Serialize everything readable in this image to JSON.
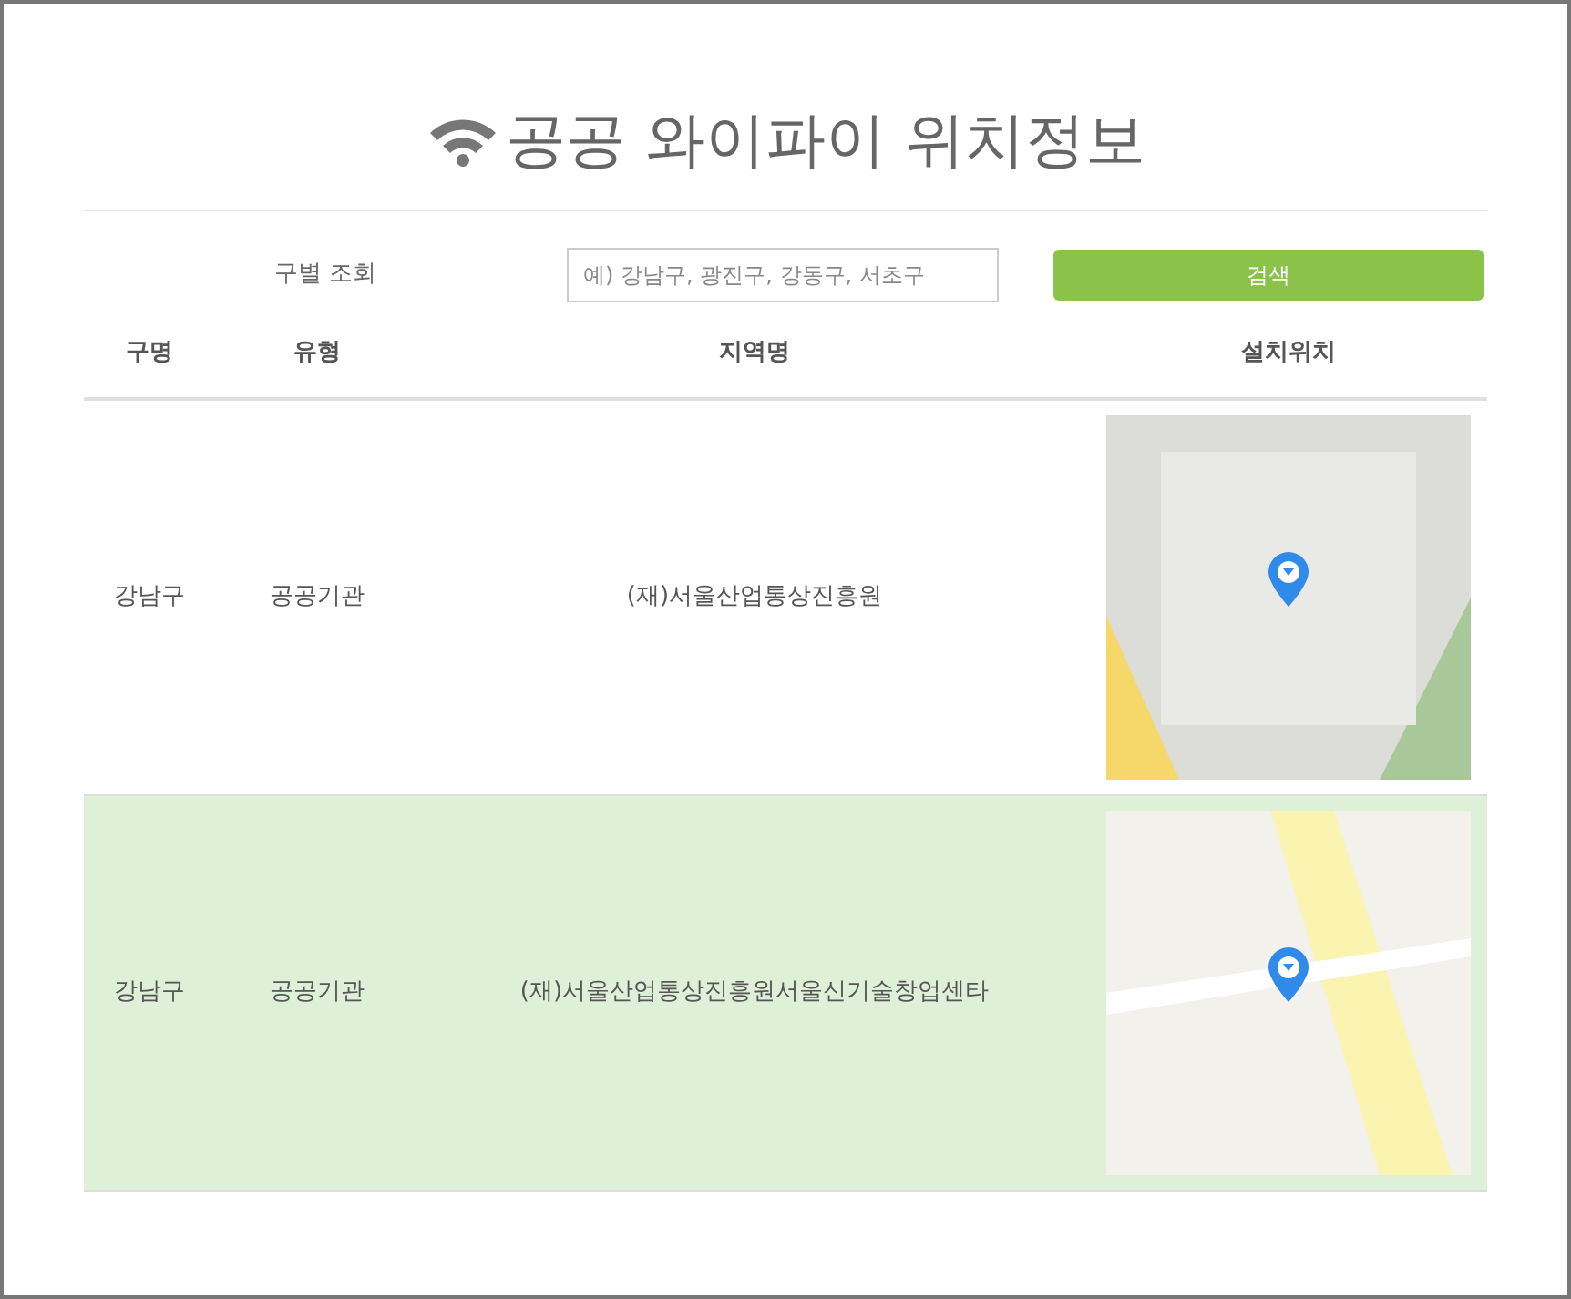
{
  "title": "공공 와이파이 위치정보",
  "search": {
    "label": "구별 조회",
    "placeholder": "예) 강남구, 광진구, 강동구, 서초구",
    "button": "검색"
  },
  "table": {
    "columns": [
      "구명",
      "유형",
      "지역명",
      "설치위치"
    ],
    "rows": [
      {
        "district": "강남구",
        "type": "공공기관",
        "place": "(재)서울산업통상진흥원",
        "highlighted": false
      },
      {
        "district": "강남구",
        "type": "공공기관",
        "place": "(재)서울산업통상진흥원서울신기술창업센타",
        "highlighted": true
      }
    ]
  }
}
